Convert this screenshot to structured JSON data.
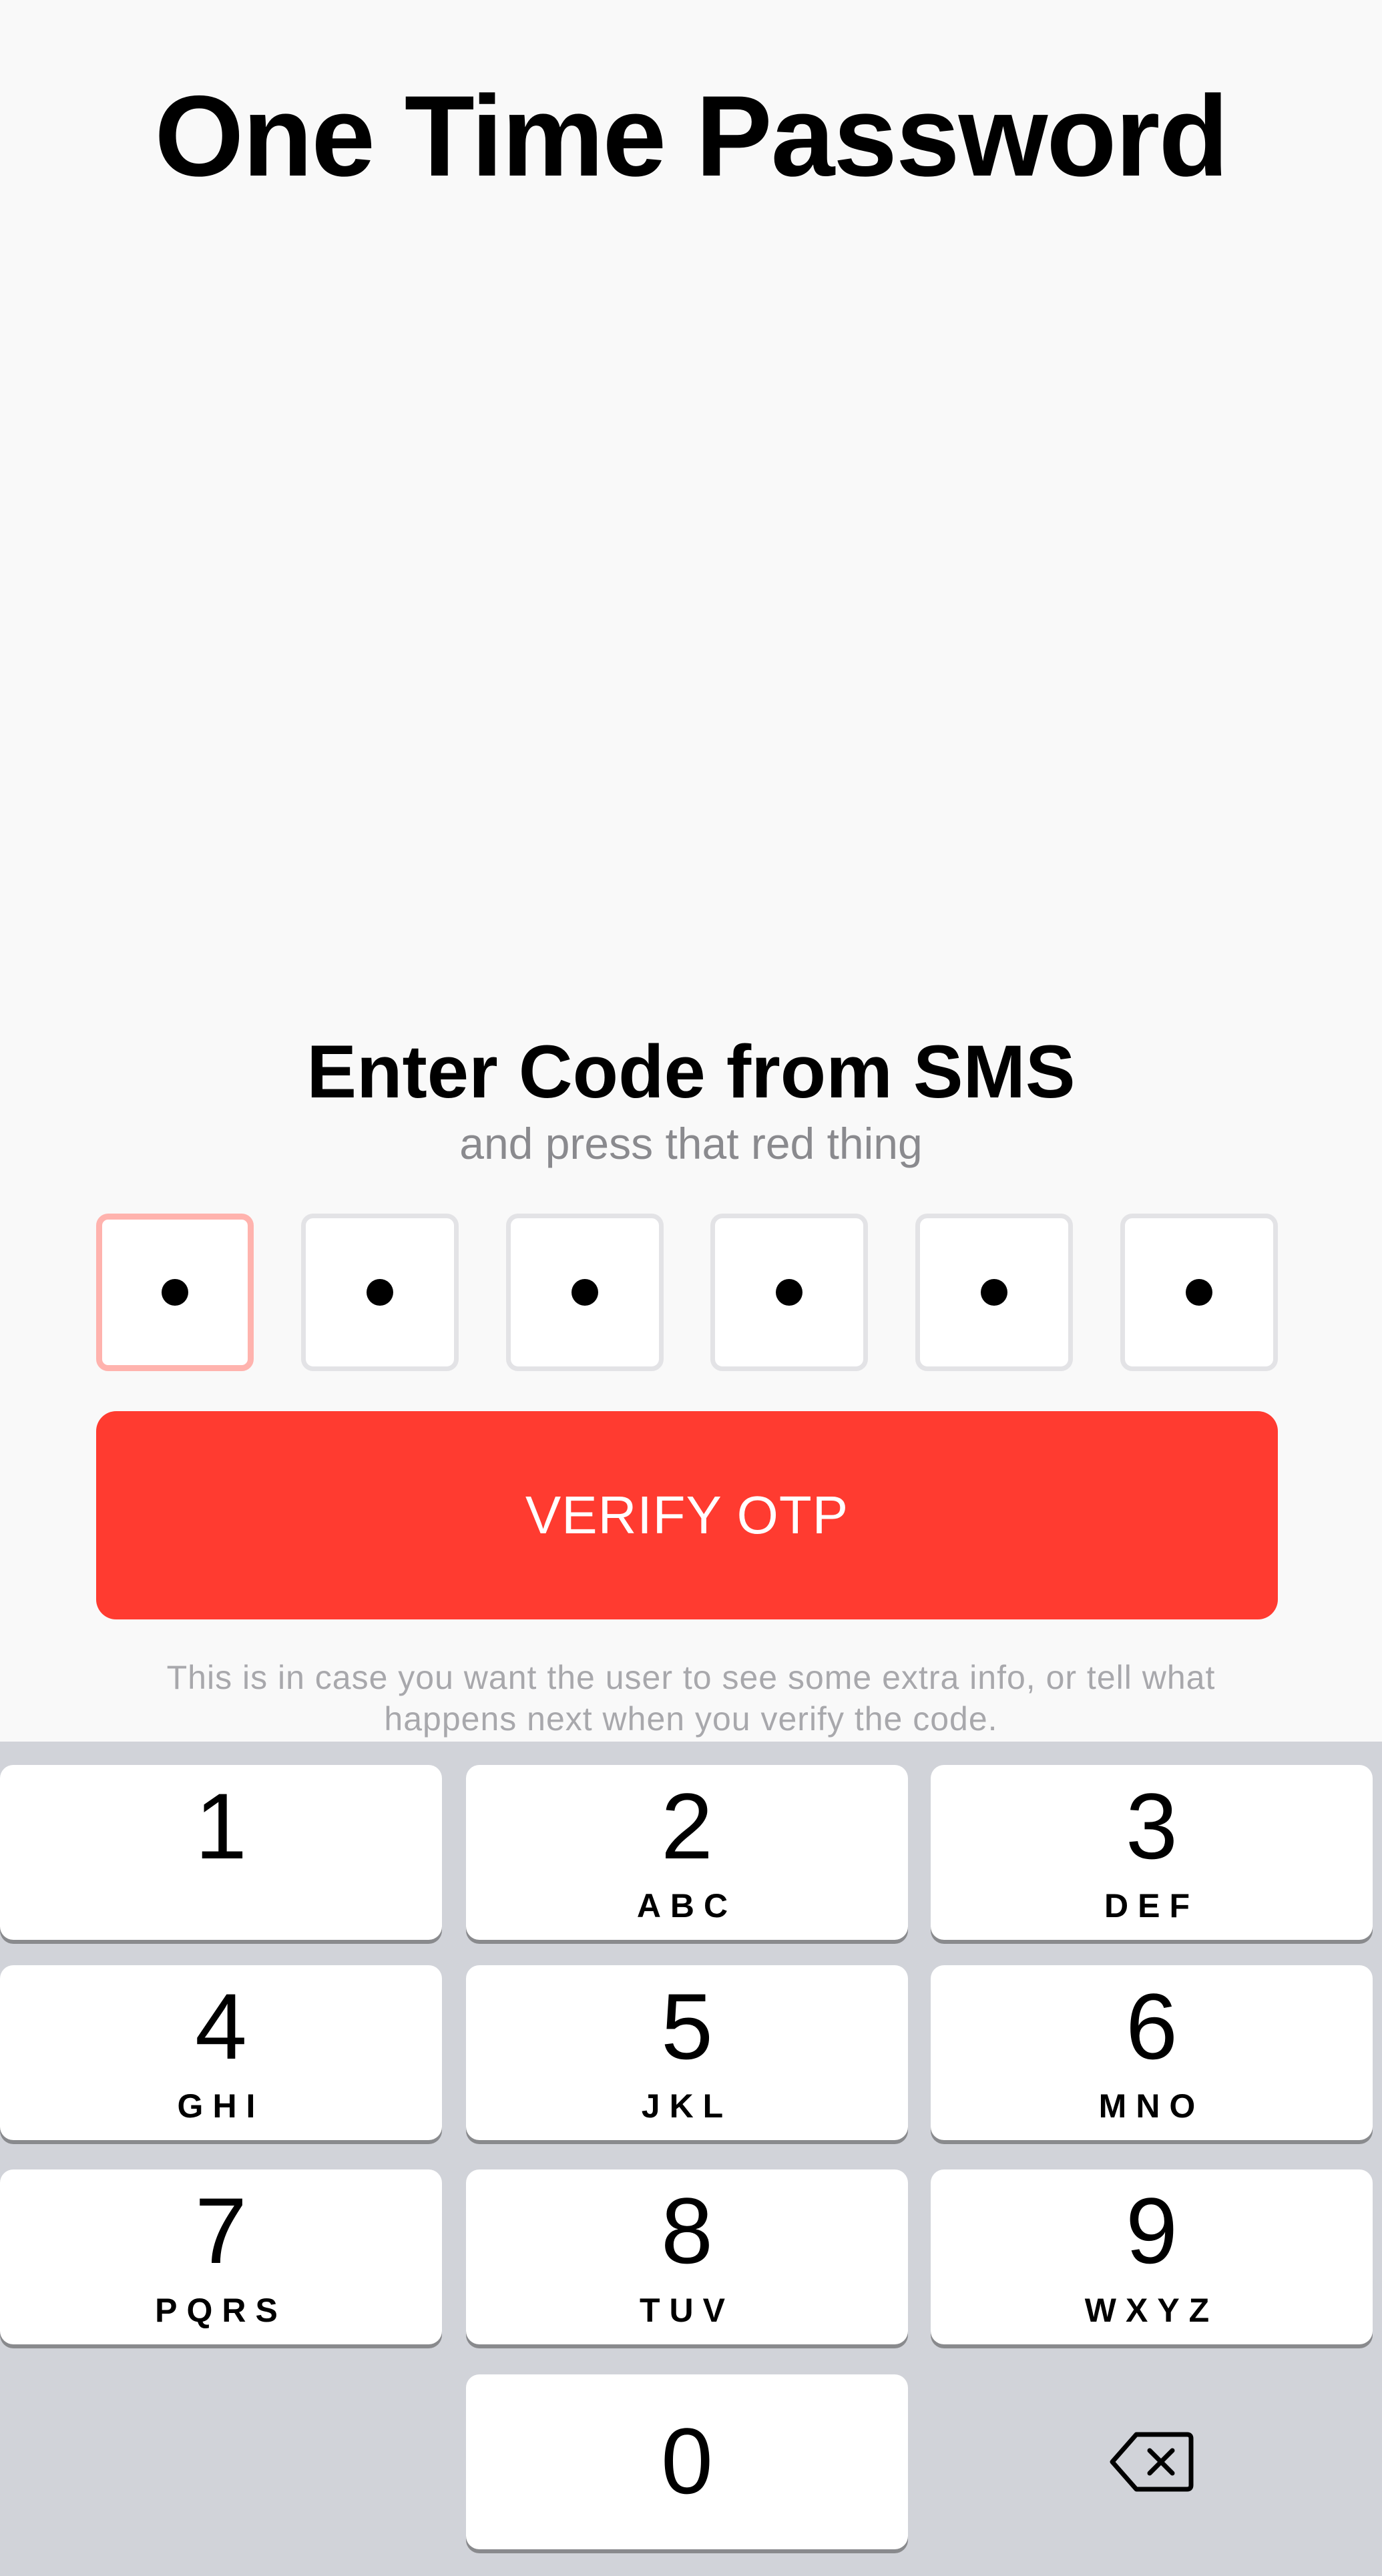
{
  "header": {
    "title": "One Time Password"
  },
  "prompt": {
    "heading": "Enter Code from SMS",
    "subheading": "and press that red thing"
  },
  "otp": {
    "digit_count": 6,
    "filled_count": 6,
    "active_index": 0,
    "mask_char": "•"
  },
  "verify_button": {
    "label": "VERIFY OTP",
    "color": "#ff3b30"
  },
  "info": {
    "text": "This is in case you want the user to see some extra info, or tell what happens next when you verify the code."
  },
  "keyboard": {
    "keys": [
      {
        "digit": "1",
        "letters": ""
      },
      {
        "digit": "2",
        "letters": "ABC"
      },
      {
        "digit": "3",
        "letters": "DEF"
      },
      {
        "digit": "4",
        "letters": "GHI"
      },
      {
        "digit": "5",
        "letters": "JKL"
      },
      {
        "digit": "6",
        "letters": "MNO"
      },
      {
        "digit": "7",
        "letters": "PQRS"
      },
      {
        "digit": "8",
        "letters": "TUV"
      },
      {
        "digit": "9",
        "letters": "WXYZ"
      },
      {
        "digit": "0",
        "letters": ""
      }
    ],
    "delete_icon": "backspace-icon"
  },
  "colors": {
    "accent": "#ff3b30",
    "active_border": "#ffb3ae",
    "keyboard_bg": "#d1d3d9"
  }
}
